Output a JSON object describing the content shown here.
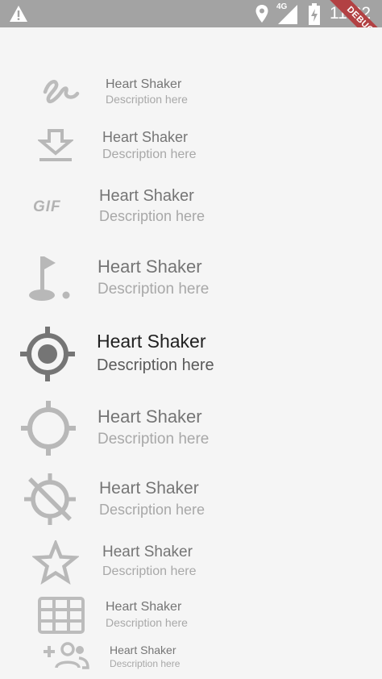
{
  "status_bar": {
    "time": "11:32",
    "network": "4G",
    "debug_banner": "DEBUG",
    "icons": [
      "warning-icon",
      "location-icon",
      "signal-icon",
      "battery-icon"
    ]
  },
  "colors": {
    "status_bar": "#a3a3a3",
    "background": "#f5f5f5",
    "icon_active": "#757575",
    "icon_faded": "#b5b5b5",
    "title_active": "#212121",
    "debug_ribbon": "#b24143"
  },
  "list": {
    "items": [
      {
        "icon": "gesture-icon",
        "title": "Heart Shaker",
        "description": "Description here"
      },
      {
        "icon": "download-icon",
        "title": "Heart Shaker",
        "description": "Description here"
      },
      {
        "icon": "gif-icon",
        "title": "Heart Shaker",
        "description": "Description here",
        "icon_text": "GIF"
      },
      {
        "icon": "golf-icon",
        "title": "Heart Shaker",
        "description": "Description here"
      },
      {
        "icon": "gps-fixed-icon",
        "title": "Heart Shaker",
        "description": "Description here"
      },
      {
        "icon": "gps-not-fixed-icon",
        "title": "Heart Shaker",
        "description": "Description here"
      },
      {
        "icon": "gps-off-icon",
        "title": "Heart Shaker",
        "description": "Description here"
      },
      {
        "icon": "star-border-icon",
        "title": "Heart Shaker",
        "description": "Description here"
      },
      {
        "icon": "grid-on-icon",
        "title": "Heart Shaker",
        "description": "Description here"
      },
      {
        "icon": "group-add-icon",
        "title": "Heart Shaker",
        "description": "Description here"
      }
    ]
  }
}
